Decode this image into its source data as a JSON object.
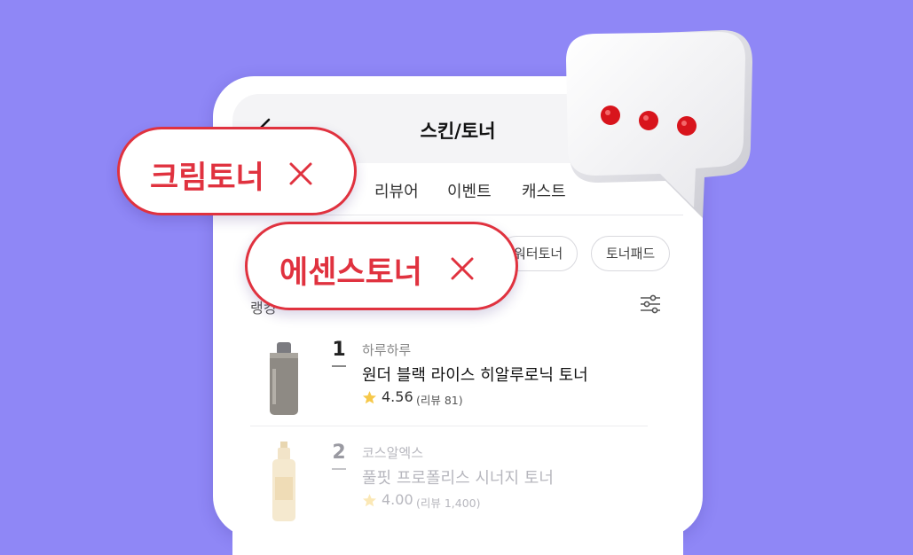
{
  "header": {
    "title": "스킨/토너"
  },
  "tabs": [
    {
      "label": "리뷰어"
    },
    {
      "label": "이벤트"
    },
    {
      "label": "캐스트"
    }
  ],
  "chips": [
    {
      "label": "워터토너"
    },
    {
      "label": "토너패드"
    }
  ],
  "ranking_label": "랭킹",
  "products": [
    {
      "rank": "1",
      "brand": "하루하루",
      "name": "원더 블랙 라이스 히알루로닉 토너",
      "rating": "4.56",
      "reviews": "(리뷰 81)"
    },
    {
      "rank": "2",
      "brand": "코스알엑스",
      "name": "풀핏 프로폴리스 시너지 토너",
      "rating": "4.00",
      "reviews": "(리뷰 1,400)"
    }
  ],
  "removed_tags": [
    {
      "label": "크림토너"
    },
    {
      "label": "에센스토너"
    }
  ],
  "icons": {
    "back": "back-arrow-icon",
    "filter": "filter-sliders-icon",
    "star": "star-icon",
    "remove": "close-icon",
    "chat": "speech-bubble-icon"
  },
  "colors": {
    "background": "#8f87f6",
    "accent": "#e0323f",
    "star": "#f6c84a",
    "chat_dots": "#d8141c"
  }
}
